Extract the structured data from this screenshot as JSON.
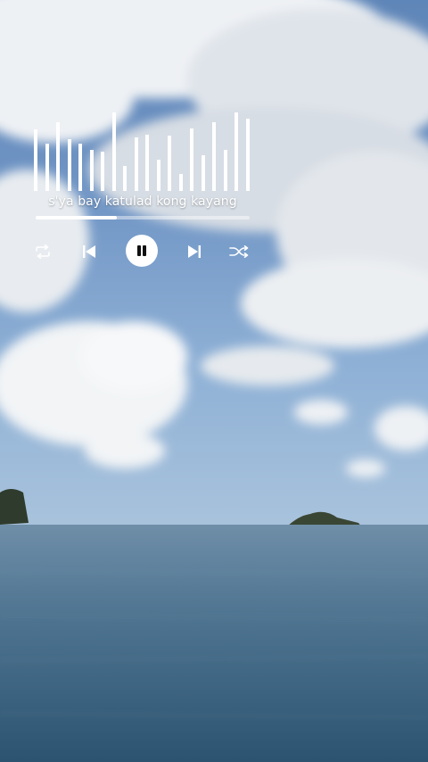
{
  "player": {
    "song_title": "s'ya bay katulad kong kayang",
    "progress": 0.38,
    "equalizer_levels": [
      0.78,
      0.6,
      0.88,
      0.66,
      0.6,
      0.52,
      0.5,
      1.0,
      0.32,
      0.68,
      0.72,
      0.4,
      0.7,
      0.22,
      0.8,
      0.45,
      0.88,
      0.52,
      1.0,
      0.92
    ],
    "icons": {
      "repeat": "repeat-icon",
      "previous": "skip-previous-icon",
      "pause": "pause-icon",
      "next": "skip-next-icon",
      "shuffle": "shuffle-icon"
    }
  },
  "colors": {
    "accent": "#ffffff",
    "pause_glyph": "#111111"
  }
}
